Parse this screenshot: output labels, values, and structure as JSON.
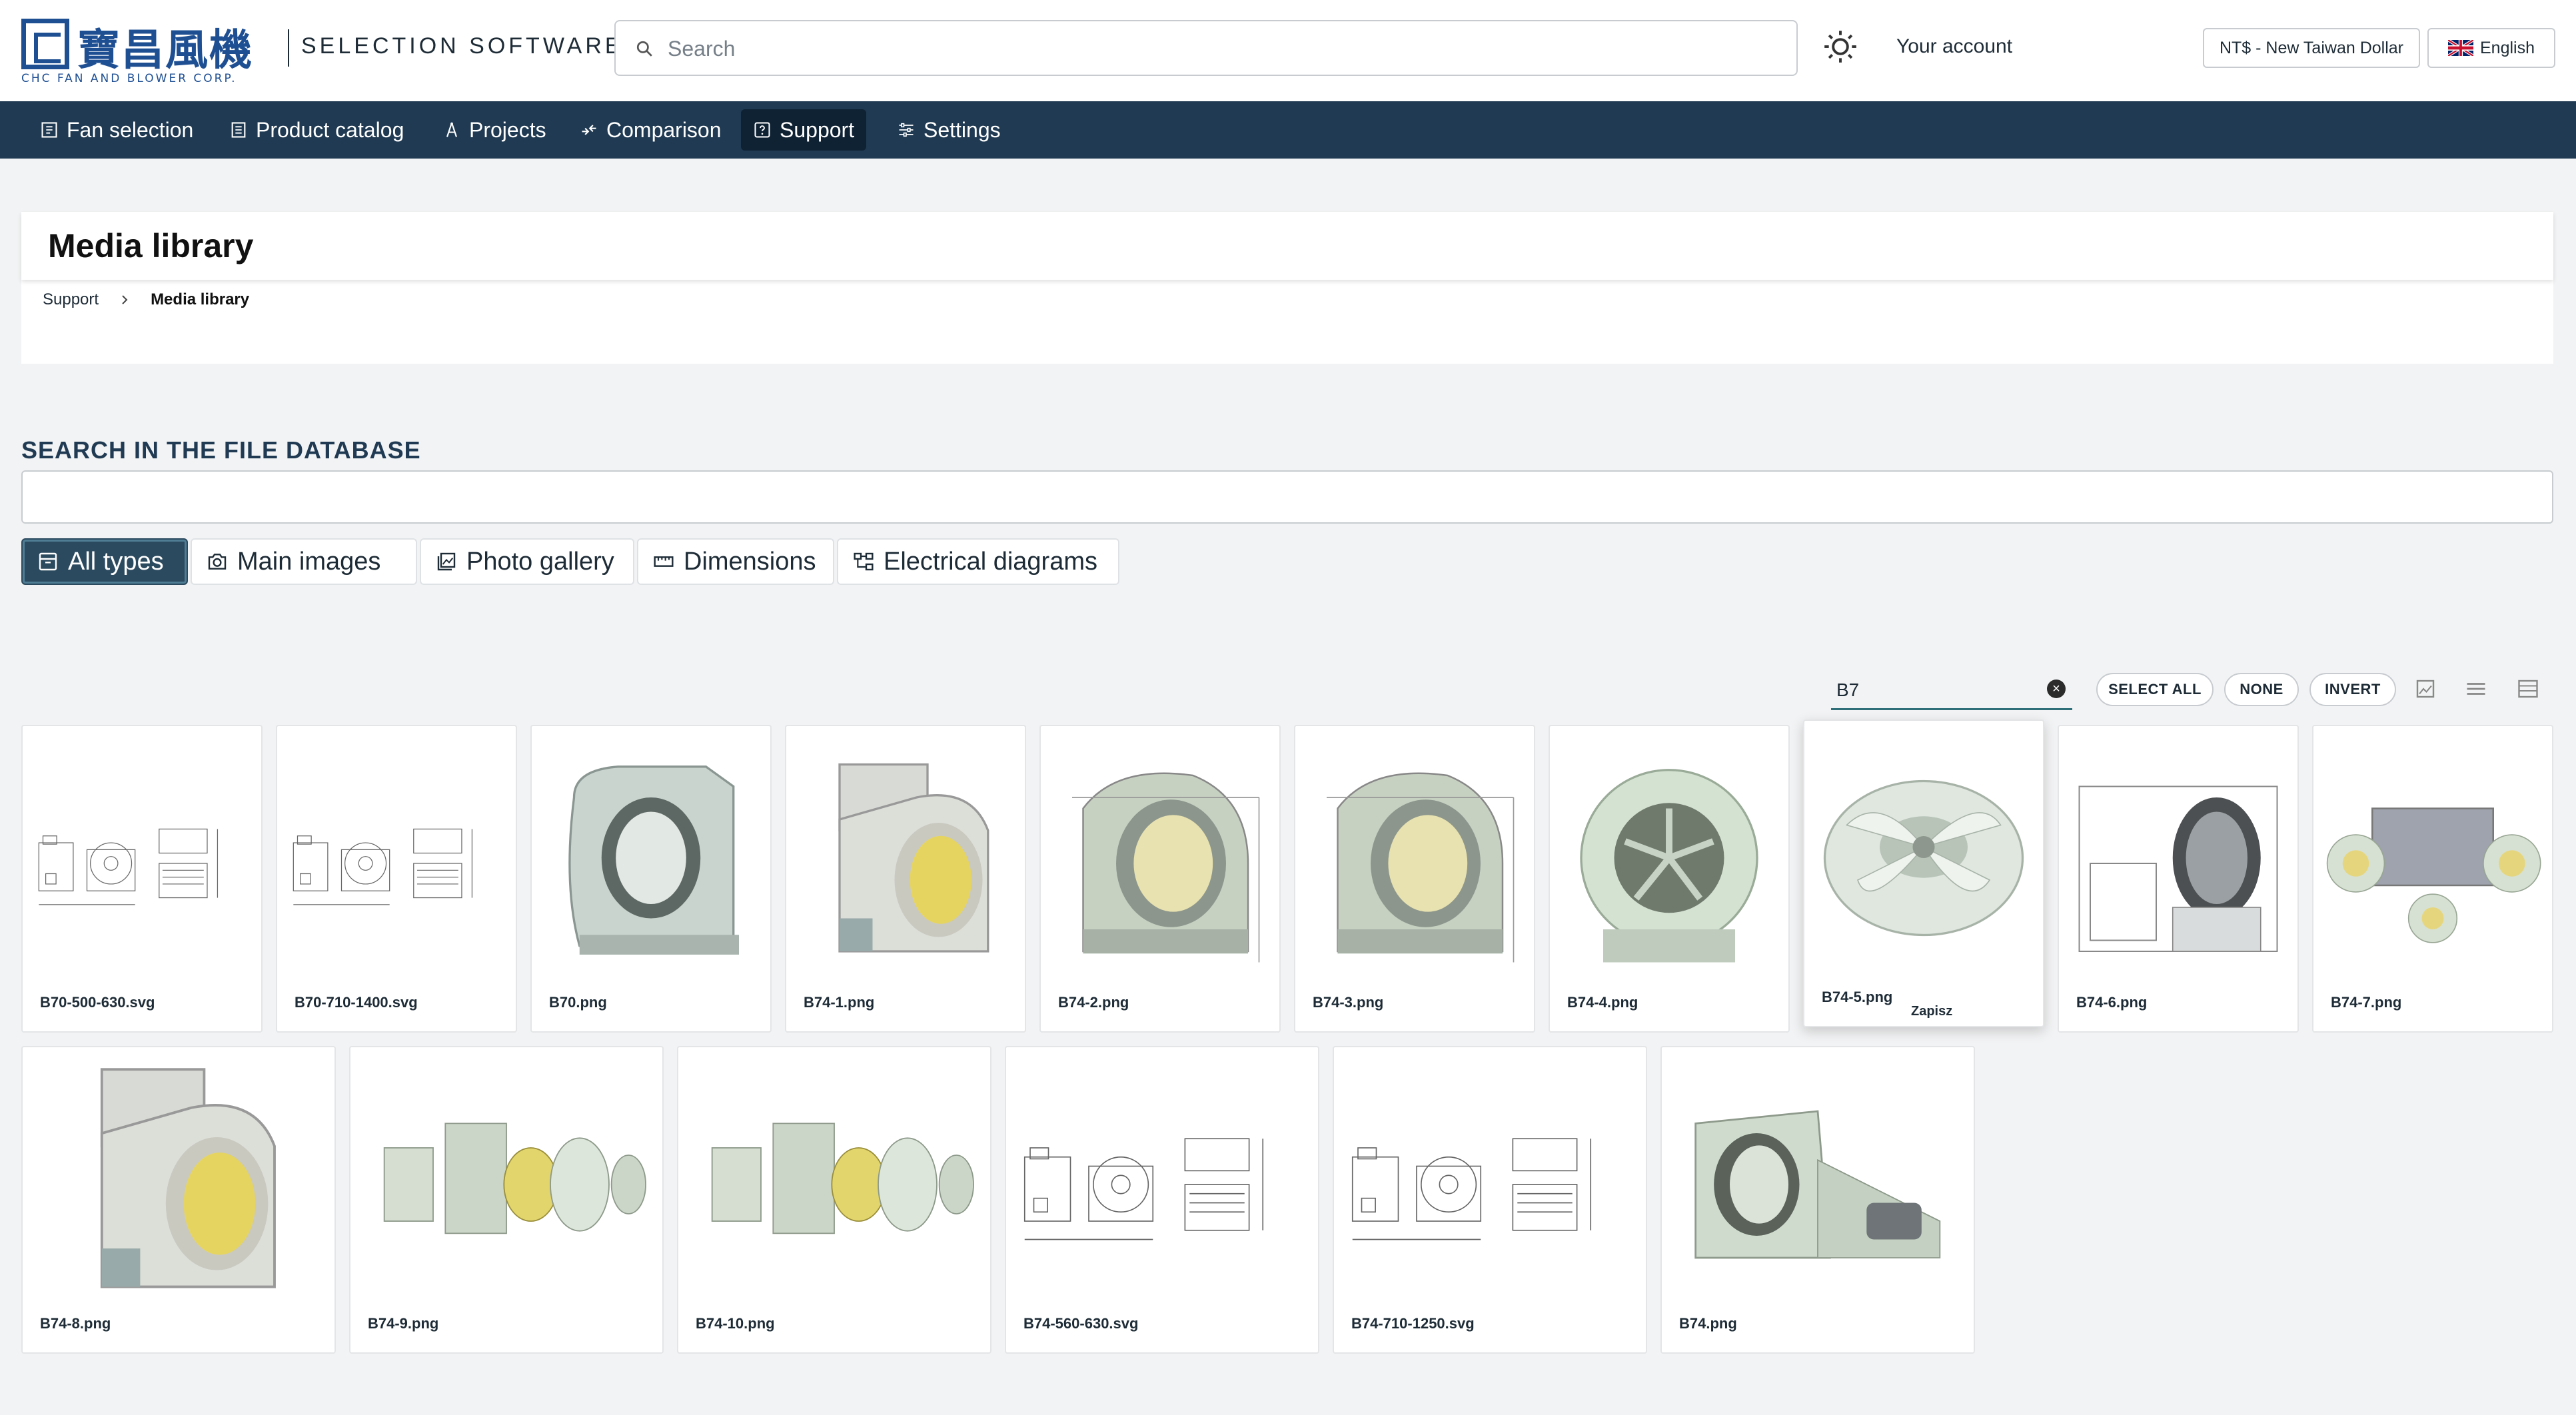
{
  "header": {
    "logo_cn": "寶昌風機",
    "logo_en": "CHC FAN AND BLOWER CORP.",
    "app_name": "SELECTION SOFTWARE",
    "search_placeholder": "Search",
    "account_label": "Your account",
    "currency_label": "NT$ - New Taiwan Dollar",
    "language_label": "English"
  },
  "nav": {
    "items": [
      {
        "label": "Fan selection",
        "icon": "grid-icon",
        "active": false
      },
      {
        "label": "Product catalog",
        "icon": "book-icon",
        "active": false
      },
      {
        "label": "Projects",
        "icon": "compass-icon",
        "active": false
      },
      {
        "label": "Comparison",
        "icon": "compare-icon",
        "active": false
      },
      {
        "label": "Support",
        "icon": "help-icon",
        "active": true
      },
      {
        "label": "Settings",
        "icon": "sliders-icon",
        "active": false
      }
    ]
  },
  "page": {
    "title": "Media library",
    "breadcrumb": [
      "Support",
      "Media library"
    ]
  },
  "database": {
    "heading": "SEARCH IN THE FILE DATABASE",
    "query": "",
    "filters": [
      {
        "label": "All types",
        "icon": "archive-icon",
        "active": true
      },
      {
        "label": "Main images",
        "icon": "camera-icon",
        "active": false
      },
      {
        "label": "Photo gallery",
        "icon": "gallery-icon",
        "active": false
      },
      {
        "label": "Dimensions",
        "icon": "ruler-icon",
        "active": false
      },
      {
        "label": "Electrical diagrams",
        "icon": "diagram-icon",
        "active": false
      }
    ]
  },
  "toolbar": {
    "name_filter_value": "B7",
    "select_all": "SELECT ALL",
    "none": "NONE",
    "invert": "INVERT",
    "views": [
      "image-view-icon",
      "list-view-icon",
      "table-view-icon"
    ]
  },
  "files": [
    {
      "name": "B70-500-630.svg",
      "kind": "drawing"
    },
    {
      "name": "B70-710-1400.svg",
      "kind": "drawing"
    },
    {
      "name": "B70.png",
      "kind": "fan-grey"
    },
    {
      "name": "B74-1.png",
      "kind": "fan-beige"
    },
    {
      "name": "B74-2.png",
      "kind": "fan-wire"
    },
    {
      "name": "B74-3.png",
      "kind": "fan-wire"
    },
    {
      "name": "B74-4.png",
      "kind": "fan-front"
    },
    {
      "name": "B74-5.png",
      "kind": "impeller",
      "tooltip": "Zapisz"
    },
    {
      "name": "B74-6.png",
      "kind": "fan-outline"
    },
    {
      "name": "B74-7.png",
      "kind": "double"
    },
    {
      "name": "B74-8.png",
      "kind": "fan-beige"
    },
    {
      "name": "B74-9.png",
      "kind": "exploded"
    },
    {
      "name": "B74-10.png",
      "kind": "exploded"
    },
    {
      "name": "B74-560-630.svg",
      "kind": "drawing"
    },
    {
      "name": "B74-710-1250.svg",
      "kind": "drawing"
    },
    {
      "name": "B74.png",
      "kind": "fan-motor"
    }
  ]
}
